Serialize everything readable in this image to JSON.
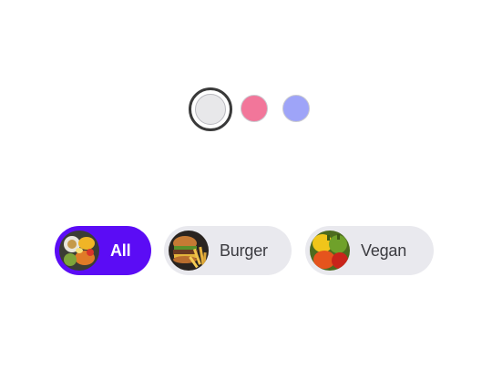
{
  "swatches": [
    {
      "name": "gray",
      "color": "#e8e8ea",
      "selected": true
    },
    {
      "name": "pink",
      "color": "#f2769a",
      "selected": false
    },
    {
      "name": "lavender",
      "color": "#9ea4f8",
      "selected": false
    }
  ],
  "chips": [
    {
      "label": "All",
      "selected": true,
      "image": "food-mix-image"
    },
    {
      "label": "Burger",
      "selected": false,
      "image": "burger-fries-image"
    },
    {
      "label": "Vegan",
      "selected": false,
      "image": "vegetables-image"
    }
  ],
  "colors": {
    "active_chip_bg": "#5b0cf5",
    "active_chip_text": "#ffffff",
    "chip_bg": "#e9e9ee",
    "chip_text": "#3b3b40"
  }
}
